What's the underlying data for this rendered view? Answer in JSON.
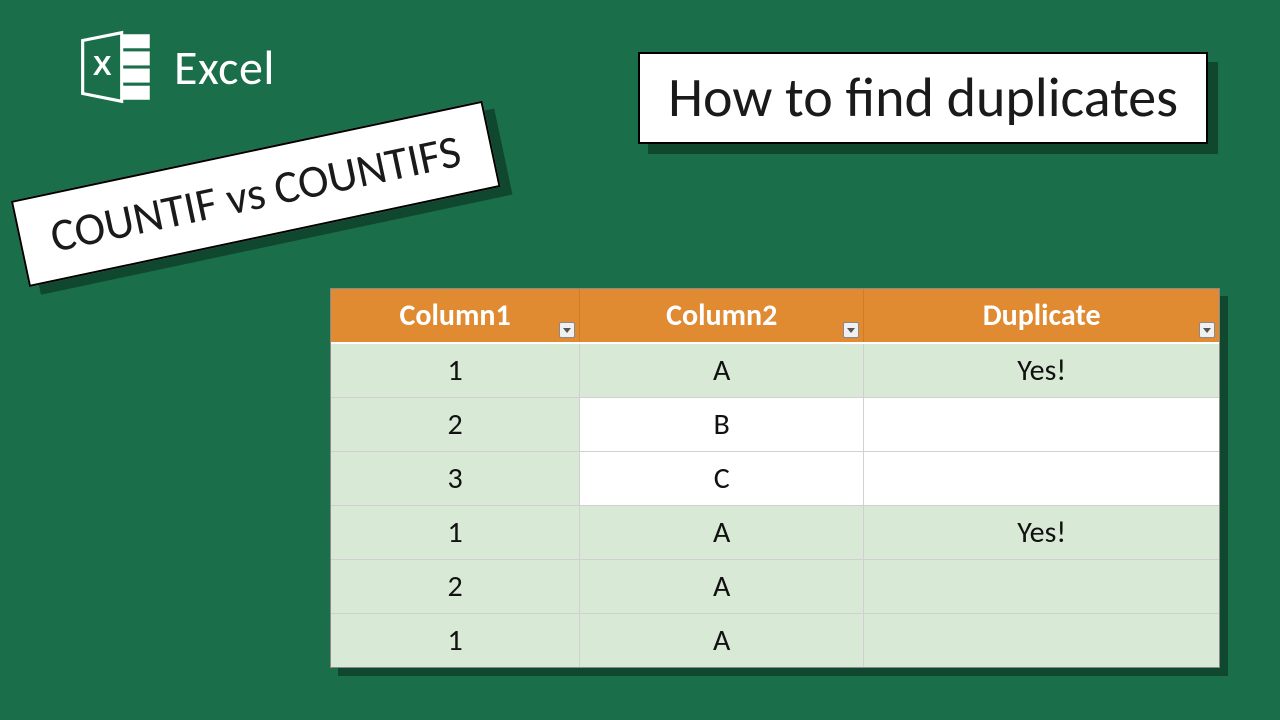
{
  "logo": {
    "app_name": "Excel"
  },
  "banners": {
    "title": "How to find duplicates",
    "rotated": "COUNTIF vs COUNTIFS"
  },
  "table": {
    "headers": {
      "col1": "Column1",
      "col2": "Column2",
      "col3": "Duplicate"
    },
    "rows": [
      {
        "c1": "1",
        "c2": "A",
        "c3": "Yes!",
        "band": true,
        "green": true
      },
      {
        "c1": "2",
        "c2": "B",
        "c3": "",
        "band": false,
        "green": false
      },
      {
        "c1": "3",
        "c2": "C",
        "c3": "",
        "band": false,
        "green": false
      },
      {
        "c1": "1",
        "c2": "A",
        "c3": "Yes!",
        "band": true,
        "green": true
      },
      {
        "c1": "2",
        "c2": "A",
        "c3": "",
        "band": true,
        "green": true
      },
      {
        "c1": "1",
        "c2": "A",
        "c3": "",
        "band": true,
        "green": true
      }
    ]
  }
}
